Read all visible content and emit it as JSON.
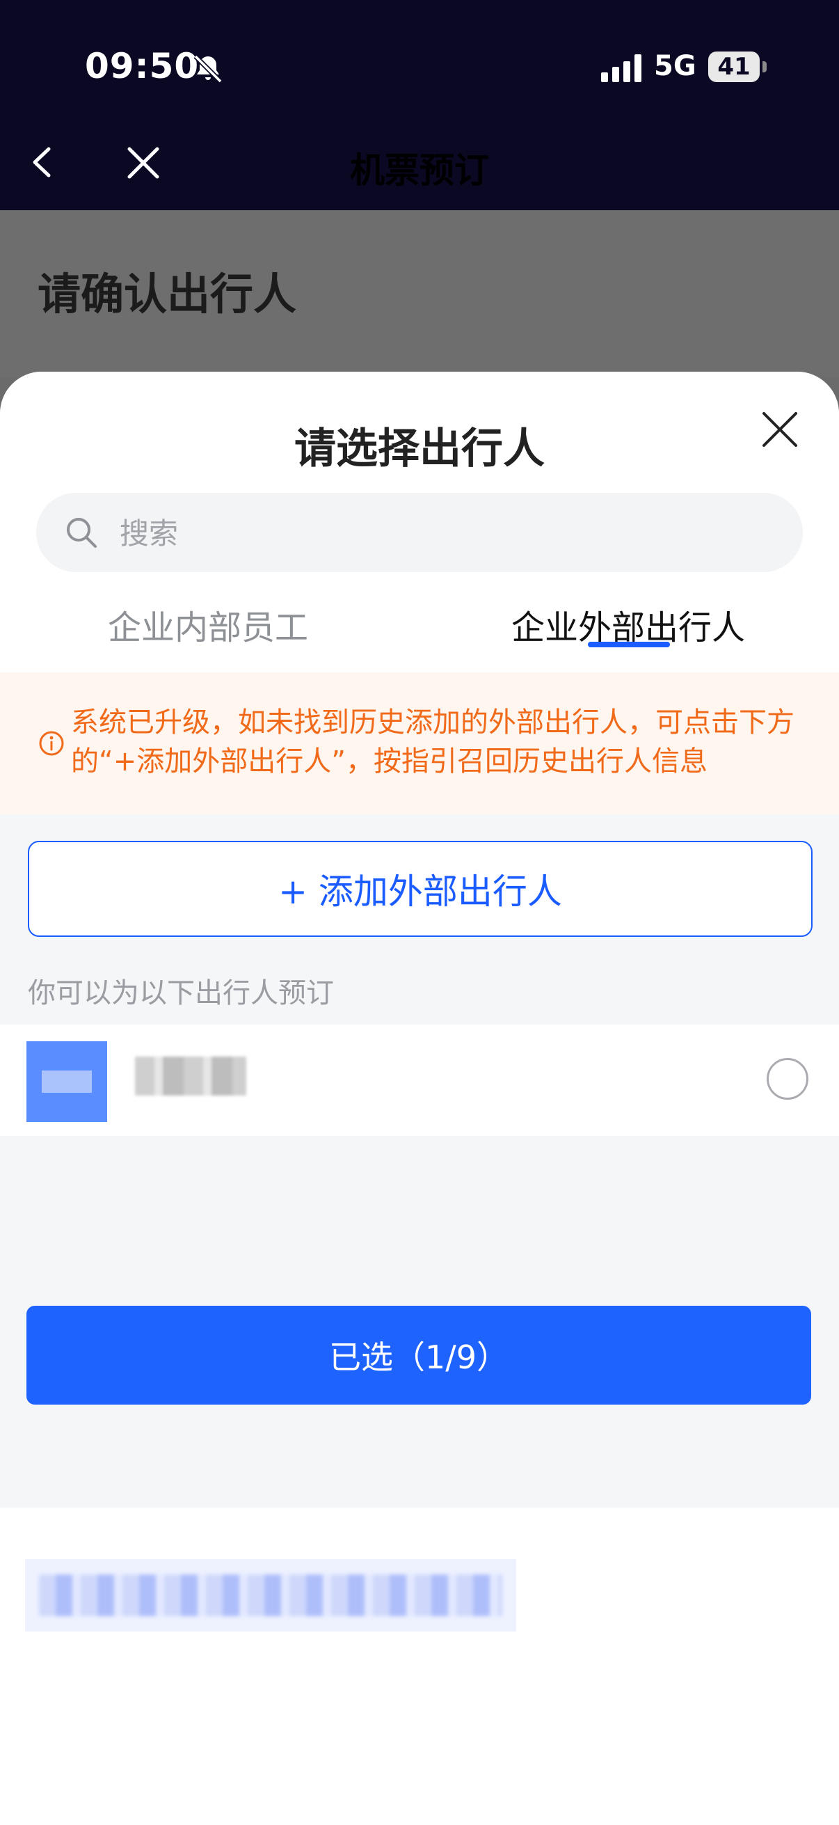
{
  "status_bar": {
    "time": "09:50",
    "network": "5G",
    "battery": "41"
  },
  "nav": {
    "title": "机票预订"
  },
  "page": {
    "title": "请确认出行人"
  },
  "sheet": {
    "title": "请选择出行人",
    "search": {
      "placeholder": "搜索",
      "value": ""
    },
    "tabs": [
      {
        "label": "企业内部员工",
        "active": false
      },
      {
        "label": "企业外部出行人",
        "active": true
      }
    ],
    "notice": "系统已升级，如未找到历史添加的外部出行人，可点击下方的“+添加外部出行人”，按指引召回历史出行人信息",
    "add_button": "+ 添加外部出行人",
    "hint": "你可以为以下出行人预订",
    "travelers": [
      {
        "name": "",
        "selected": false
      }
    ],
    "selected_chip": "",
    "confirm_button": "已选（1/9）"
  },
  "colors": {
    "header_bg": "#0a0823",
    "accent": "#1a5cff",
    "notice_text": "#f06a1a",
    "notice_bg": "#fff6f0"
  },
  "icons": [
    "bell-slash-icon",
    "signal-icon",
    "back-icon",
    "close-icon",
    "search-icon",
    "info-icon"
  ]
}
